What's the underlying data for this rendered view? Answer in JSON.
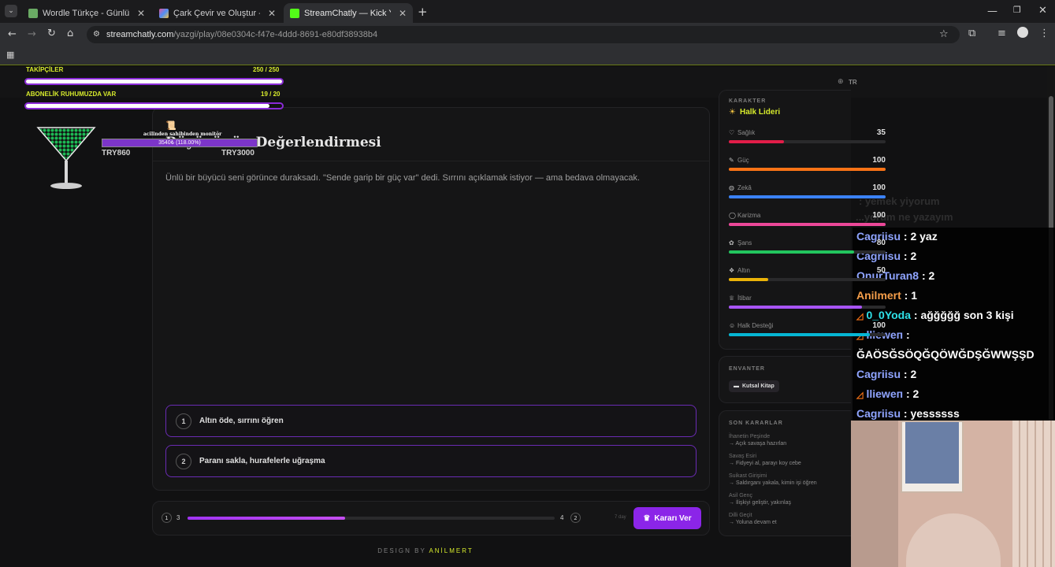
{
  "browser": {
    "tabs": [
      {
        "title": "Wordle Türkçe - Günlük Kelime",
        "fav_color": "#6aaa64"
      },
      {
        "title": "Çark Çevir ve Oluştur - Ücretsiz",
        "fav_color": "#e0569b"
      },
      {
        "title": "StreamChatly — Kick Yayıncıları",
        "fav_color": "#53fc18"
      }
    ],
    "new_tab": "+",
    "url_domain": "streamchatly.com",
    "url_path": "/yazgi/play/08e0304c-f47e-4ddd-8691-e80df38938b4"
  },
  "overlay": {
    "stat1_label": "TAKİPÇİLER",
    "stat1_value": "250 / 250",
    "stat1_fraction": 1.0,
    "stat2_label": "ABONELİK RUHUMUZDA VAR",
    "stat2_value": "19 / 20",
    "stat2_fraction": 0.95,
    "donation_title": "acilinden sahibinden monitör",
    "donation_progress": "3540₺ (118.00%)",
    "donation_current": "TRY860",
    "donation_goal": "TRY3000"
  },
  "game": {
    "lang": "TR",
    "title": "Büyücünün Değerlendirmesi",
    "story": "Ünlü bir büyücü seni görünce duraksadı. \"Sende garip bir güç var\" dedi. Sırrını açıklamak istiyor — ama bedava olmayacak.",
    "choices": [
      {
        "num": "1",
        "text": "Altın öde, sırrını öğren"
      },
      {
        "num": "2",
        "text": "Paranı sakla, hurafelerle uğraşma"
      }
    ],
    "progress": {
      "start_circle": "1",
      "start": "3",
      "end": "4",
      "end_circle": "2",
      "fraction": 0.43,
      "hint": "7 day"
    },
    "decide_button": "Kararı Ver",
    "footer_prefix": "DESIGN BY ",
    "footer_name": "ANİLMERT"
  },
  "character": {
    "section": "KARAKTER",
    "name": "Halk Lideri",
    "stats": [
      {
        "label": "Sağlık",
        "value": "35",
        "fraction": 0.35,
        "color": "#e11d48"
      },
      {
        "label": "Güç",
        "value": "100",
        "fraction": 1.0,
        "color": "#f97316"
      },
      {
        "label": "Zekâ",
        "value": "100",
        "fraction": 1.0,
        "color": "#3b82f6"
      },
      {
        "label": "Karizma",
        "value": "100",
        "fraction": 1.0,
        "color": "#ec4899"
      },
      {
        "label": "Şans",
        "value": "80",
        "fraction": 0.8,
        "color": "#22c55e"
      },
      {
        "label": "Altın",
        "value": "50",
        "fraction": 0.25,
        "color": "#eab308"
      },
      {
        "label": "İtibar",
        "value": "",
        "fraction": 0.85,
        "color": "#a855f7"
      },
      {
        "label": "Halk Desteği",
        "value": "100",
        "fraction": 0.9,
        "color": "#06b6d4"
      }
    ]
  },
  "inventory": {
    "section": "ENVANTER",
    "item": "Kutsal Kitap"
  },
  "decisions": {
    "section": "SON KARARLAR",
    "items": [
      {
        "name": "İhanetin Peşinde",
        "value": "→ Açık savaşa hazırlan"
      },
      {
        "name": "Savaş Esiri",
        "value": "→ Fidyeyi al, parayı koy cebe"
      },
      {
        "name": "Suikast Girişimi",
        "value": "→ Saldırganı yakala, kimin işi öğren"
      },
      {
        "name": "Asil Genç",
        "value": "→ İlişkiyi geliştir, yakınlaş"
      },
      {
        "name": "Dilli Geçit",
        "value": "→ Yoluna devam et"
      }
    ]
  },
  "chat": {
    "faded": ": yemek yiyorum",
    "faded2": "...yorum ne yazayım",
    "messages": [
      {
        "user": "Cagriisu",
        "text": " : 2 yaz",
        "color": "#8fa4ff",
        "badge": ""
      },
      {
        "user": "Cagriisu",
        "text": " : 2",
        "color": "#8fa4ff",
        "badge": ""
      },
      {
        "user": "OnurTuran8",
        "text": " : 2",
        "color": "#8fa4ff",
        "badge": ""
      },
      {
        "user": "Anilmert",
        "text": " : 1",
        "color": "#f59e4a",
        "badge": ""
      },
      {
        "user": "0_0Yoda",
        "text": " : ağğğğğ son 3 kişi",
        "color": "#2fe1e8",
        "badge": "◿"
      },
      {
        "user": "llieweп",
        "text": " :",
        "color": "#8fa4ff",
        "badge": "◿"
      },
      {
        "user": "",
        "text": "ĞAÖSĞSÖQĞQÖWĞDŞĞWWŞŞD",
        "color": "#ffffff",
        "badge": ""
      },
      {
        "user": "Cagriisu",
        "text": " : 2",
        "color": "#8fa4ff",
        "badge": ""
      },
      {
        "user": "llieweп",
        "text": " : 2",
        "color": "#8fa4ff",
        "badge": "◿"
      },
      {
        "user": "Cagriisu",
        "text": " : yessssss",
        "color": "#8fa4ff",
        "badge": ""
      }
    ]
  }
}
